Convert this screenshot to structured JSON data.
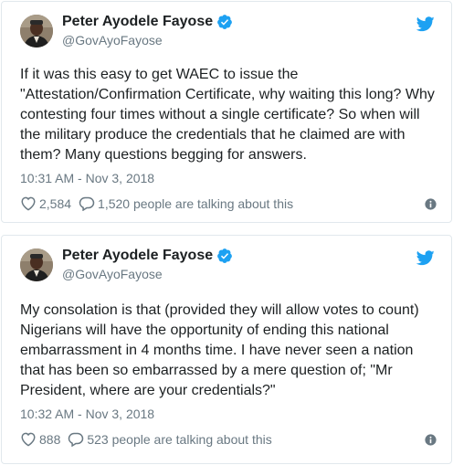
{
  "colors": {
    "verified": "#1da1f2",
    "twitter_bird": "#1da1f2",
    "meta_text": "#697882",
    "border": "#e1e8ed"
  },
  "tweets": [
    {
      "author": {
        "name": "Peter Ayodele Fayose",
        "handle": "@GovAyoFayose",
        "verified": true
      },
      "text": "If it was this easy to get WAEC to issue the\n\"Attestation/Confirmation Certificate, why waiting this long? Why\ncontesting four times without a single certificate? So when will\nthe military produce the credentials that he claimed are with\nthem? Many questions begging for answers.",
      "timestamp": "10:31 AM - Nov 3, 2018",
      "likes": "2,584",
      "talking": "1,520 people are talking about this",
      "icons": [
        "heart-icon",
        "reply-icon",
        "info-icon",
        "twitter-bird-icon",
        "verified-icon"
      ]
    },
    {
      "author": {
        "name": "Peter Ayodele Fayose",
        "handle": "@GovAyoFayose",
        "verified": true
      },
      "text": "My consolation is that (provided they will allow votes to count)\nNigerians will have the opportunity of ending this national\nembarrassment in 4 months time. I have never seen a nation\nthat has been so embarrassed by a mere question of; \"Mr\nPresident, where are your credentials?\"",
      "timestamp": "10:32 AM - Nov 3, 2018",
      "likes": "888",
      "talking": "523 people are talking about this",
      "icons": [
        "heart-icon",
        "reply-icon",
        "info-icon",
        "twitter-bird-icon",
        "verified-icon"
      ]
    }
  ]
}
